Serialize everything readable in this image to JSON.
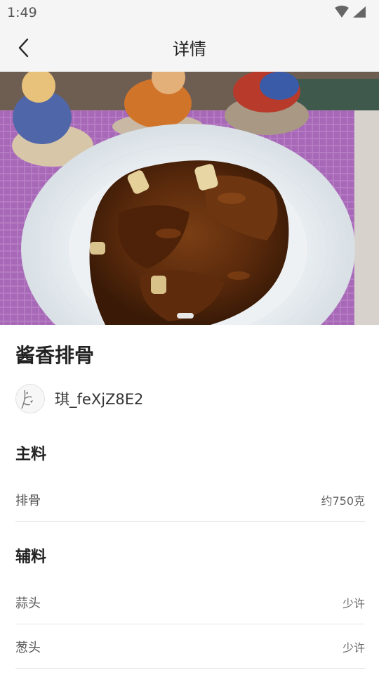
{
  "status_bar": {
    "time": "1:49"
  },
  "app_bar": {
    "title": "详情"
  },
  "recipe": {
    "name": "酱香排骨",
    "author": "琪_feXjZ8E2"
  },
  "main_ingredients": {
    "title": "主料",
    "items": [
      {
        "name": "排骨",
        "amount": "约750克"
      }
    ]
  },
  "aux_ingredients": {
    "title": "辅料",
    "items": [
      {
        "name": "蒜头",
        "amount": "少许"
      },
      {
        "name": "葱头",
        "amount": "少许"
      }
    ]
  }
}
